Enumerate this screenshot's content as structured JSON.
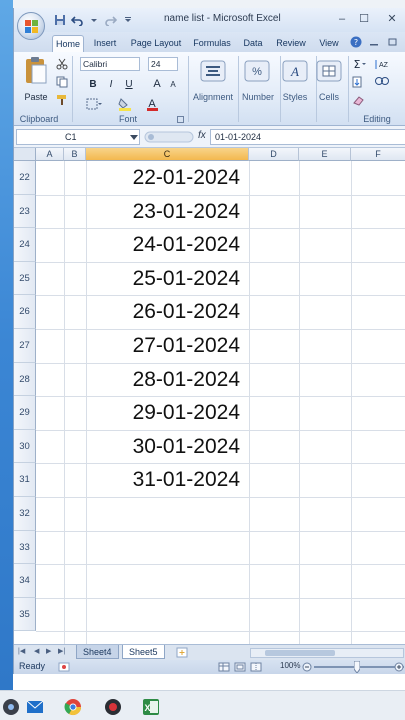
{
  "window": {
    "title": "name list - Microsoft Excel",
    "minimize_glyph": "–",
    "maximize_glyph": "☐",
    "close_glyph": "✕"
  },
  "ribbon": {
    "tabs": [
      "Home",
      "Insert",
      "Page Layout",
      "Formulas",
      "Data",
      "Review",
      "View"
    ],
    "active_tab": "Home",
    "clipboard": {
      "paste_label": "Paste",
      "group_label": "Clipboard"
    },
    "font": {
      "font_name": "Calibri",
      "font_size": "24",
      "bold": "B",
      "italic": "I",
      "underline": "U",
      "grow": "A",
      "shrink": "A",
      "group_label": "Font"
    },
    "alignment_label": "Alignment",
    "number_label": "Number",
    "styles_label": "Styles",
    "cells_label": "Cells",
    "editing_label": "Editing"
  },
  "formula_bar": {
    "name_box": "C1",
    "fx_label": "fx",
    "formula": "01-01-2024"
  },
  "grid": {
    "columns": [
      "A",
      "B",
      "C",
      "D",
      "E",
      "F"
    ],
    "selected_column": "C",
    "rows": [
      {
        "num": "22",
        "c": "22-01-2024"
      },
      {
        "num": "23",
        "c": "23-01-2024"
      },
      {
        "num": "24",
        "c": "24-01-2024"
      },
      {
        "num": "25",
        "c": "25-01-2024"
      },
      {
        "num": "26",
        "c": "26-01-2024"
      },
      {
        "num": "27",
        "c": "27-01-2024"
      },
      {
        "num": "28",
        "c": "28-01-2024"
      },
      {
        "num": "29",
        "c": "29-01-2024"
      },
      {
        "num": "30",
        "c": "30-01-2024"
      },
      {
        "num": "31",
        "c": "31-01-2024"
      },
      {
        "num": "32",
        "c": ""
      },
      {
        "num": "33",
        "c": ""
      },
      {
        "num": "34",
        "c": ""
      },
      {
        "num": "35",
        "c": ""
      }
    ]
  },
  "sheets": {
    "tabs": [
      "Sheet4",
      "Sheet5"
    ],
    "active": "Sheet5"
  },
  "status": {
    "ready": "Ready",
    "zoom": "100%"
  },
  "colors": {
    "selected_header": "#f3b84f",
    "ribbon_bg": "#e3ecf8",
    "desktop": "#3b86d4"
  }
}
